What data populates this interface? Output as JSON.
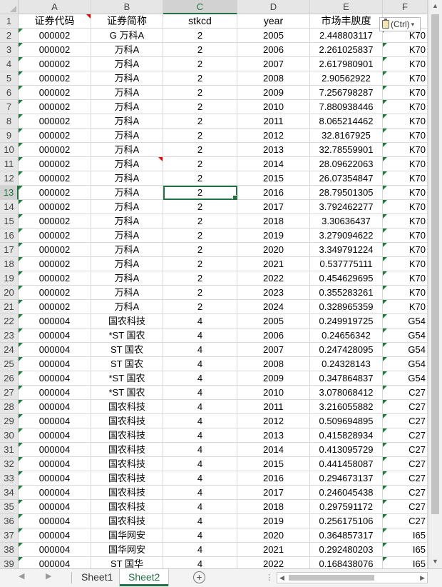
{
  "columns": [
    "A",
    "B",
    "C",
    "D",
    "E",
    "F"
  ],
  "selected_column": "C",
  "selected_row": "13",
  "header": [
    "证券代码",
    "证券简称",
    "stkcd",
    "year",
    "市场丰腴度",
    ""
  ],
  "rows": [
    [
      "000002",
      "G 万科A",
      "2",
      "2005",
      "2.448803117",
      "K70"
    ],
    [
      "000002",
      "万科A",
      "2",
      "2006",
      "2.261025837",
      "K70"
    ],
    [
      "000002",
      "万科A",
      "2",
      "2007",
      "2.617980901",
      "K70"
    ],
    [
      "000002",
      "万科A",
      "2",
      "2008",
      "2.90562922",
      "K70"
    ],
    [
      "000002",
      "万科A",
      "2",
      "2009",
      "7.256798287",
      "K70"
    ],
    [
      "000002",
      "万科A",
      "2",
      "2010",
      "7.880938446",
      "K70"
    ],
    [
      "000002",
      "万科A",
      "2",
      "2011",
      "8.065214462",
      "K70"
    ],
    [
      "000002",
      "万科A",
      "2",
      "2012",
      "32.8167925",
      "K70"
    ],
    [
      "000002",
      "万科A",
      "2",
      "2013",
      "32.78559901",
      "K70"
    ],
    [
      "000002",
      "万科A",
      "2",
      "2014",
      "28.09622063",
      "K70"
    ],
    [
      "000002",
      "万科A",
      "2",
      "2015",
      "26.07354847",
      "K70"
    ],
    [
      "000002",
      "万科A",
      "2",
      "2016",
      "28.79501305",
      "K70"
    ],
    [
      "000002",
      "万科A",
      "2",
      "2017",
      "3.792462277",
      "K70"
    ],
    [
      "000002",
      "万科A",
      "2",
      "2018",
      "3.30636437",
      "K70"
    ],
    [
      "000002",
      "万科A",
      "2",
      "2019",
      "3.279094622",
      "K70"
    ],
    [
      "000002",
      "万科A",
      "2",
      "2020",
      "3.349791224",
      "K70"
    ],
    [
      "000002",
      "万科A",
      "2",
      "2021",
      "0.537775111",
      "K70"
    ],
    [
      "000002",
      "万科A",
      "2",
      "2022",
      "0.454629695",
      "K70"
    ],
    [
      "000002",
      "万科A",
      "2",
      "2023",
      "0.355283261",
      "K70"
    ],
    [
      "000002",
      "万科A",
      "2",
      "2024",
      "0.328965359",
      "K70"
    ],
    [
      "000004",
      "国农科技",
      "4",
      "2005",
      "0.249919725",
      "G54"
    ],
    [
      "000004",
      "*ST 国农",
      "4",
      "2006",
      "0.24656342",
      "G54"
    ],
    [
      "000004",
      "ST 国农",
      "4",
      "2007",
      "0.247428095",
      "G54"
    ],
    [
      "000004",
      "ST 国农",
      "4",
      "2008",
      "0.24328143",
      "G54"
    ],
    [
      "000004",
      "*ST 国农",
      "4",
      "2009",
      "0.347864837",
      "G54"
    ],
    [
      "000004",
      "*ST 国农",
      "4",
      "2010",
      "3.078068412",
      "C27"
    ],
    [
      "000004",
      "国农科技",
      "4",
      "2011",
      "3.216055882",
      "C27"
    ],
    [
      "000004",
      "国农科技",
      "4",
      "2012",
      "0.509694895",
      "C27"
    ],
    [
      "000004",
      "国农科技",
      "4",
      "2013",
      "0.415828934",
      "C27"
    ],
    [
      "000004",
      "国农科技",
      "4",
      "2014",
      "0.413095729",
      "C27"
    ],
    [
      "000004",
      "国农科技",
      "4",
      "2015",
      "0.441458087",
      "C27"
    ],
    [
      "000004",
      "国农科技",
      "4",
      "2016",
      "0.294673137",
      "C27"
    ],
    [
      "000004",
      "国农科技",
      "4",
      "2017",
      "0.246045438",
      "C27"
    ],
    [
      "000004",
      "国农科技",
      "4",
      "2018",
      "0.297591172",
      "C27"
    ],
    [
      "000004",
      "国农科技",
      "4",
      "2019",
      "0.256175106",
      "C27"
    ],
    [
      "000004",
      "国华网安",
      "4",
      "2020",
      "0.364857317",
      "I65"
    ],
    [
      "000004",
      "国华网安",
      "4",
      "2021",
      "0.292480203",
      "I65"
    ],
    [
      "000004",
      "ST 国华",
      "4",
      "2022",
      "0.168438076",
      "I65"
    ]
  ],
  "paste_options": {
    "label": "(Ctrl)",
    "arrow": "▾"
  },
  "sheets": [
    {
      "name": "Sheet1",
      "active": false
    },
    {
      "name": "Sheet2",
      "active": true
    }
  ],
  "add_sheet_symbol": "+",
  "sheet_nav": {
    "prev": "◀",
    "next": "▶"
  },
  "dots": "⋮",
  "scroll": {
    "up": "▲",
    "down": "▼",
    "left": "◀",
    "right": "▶"
  }
}
